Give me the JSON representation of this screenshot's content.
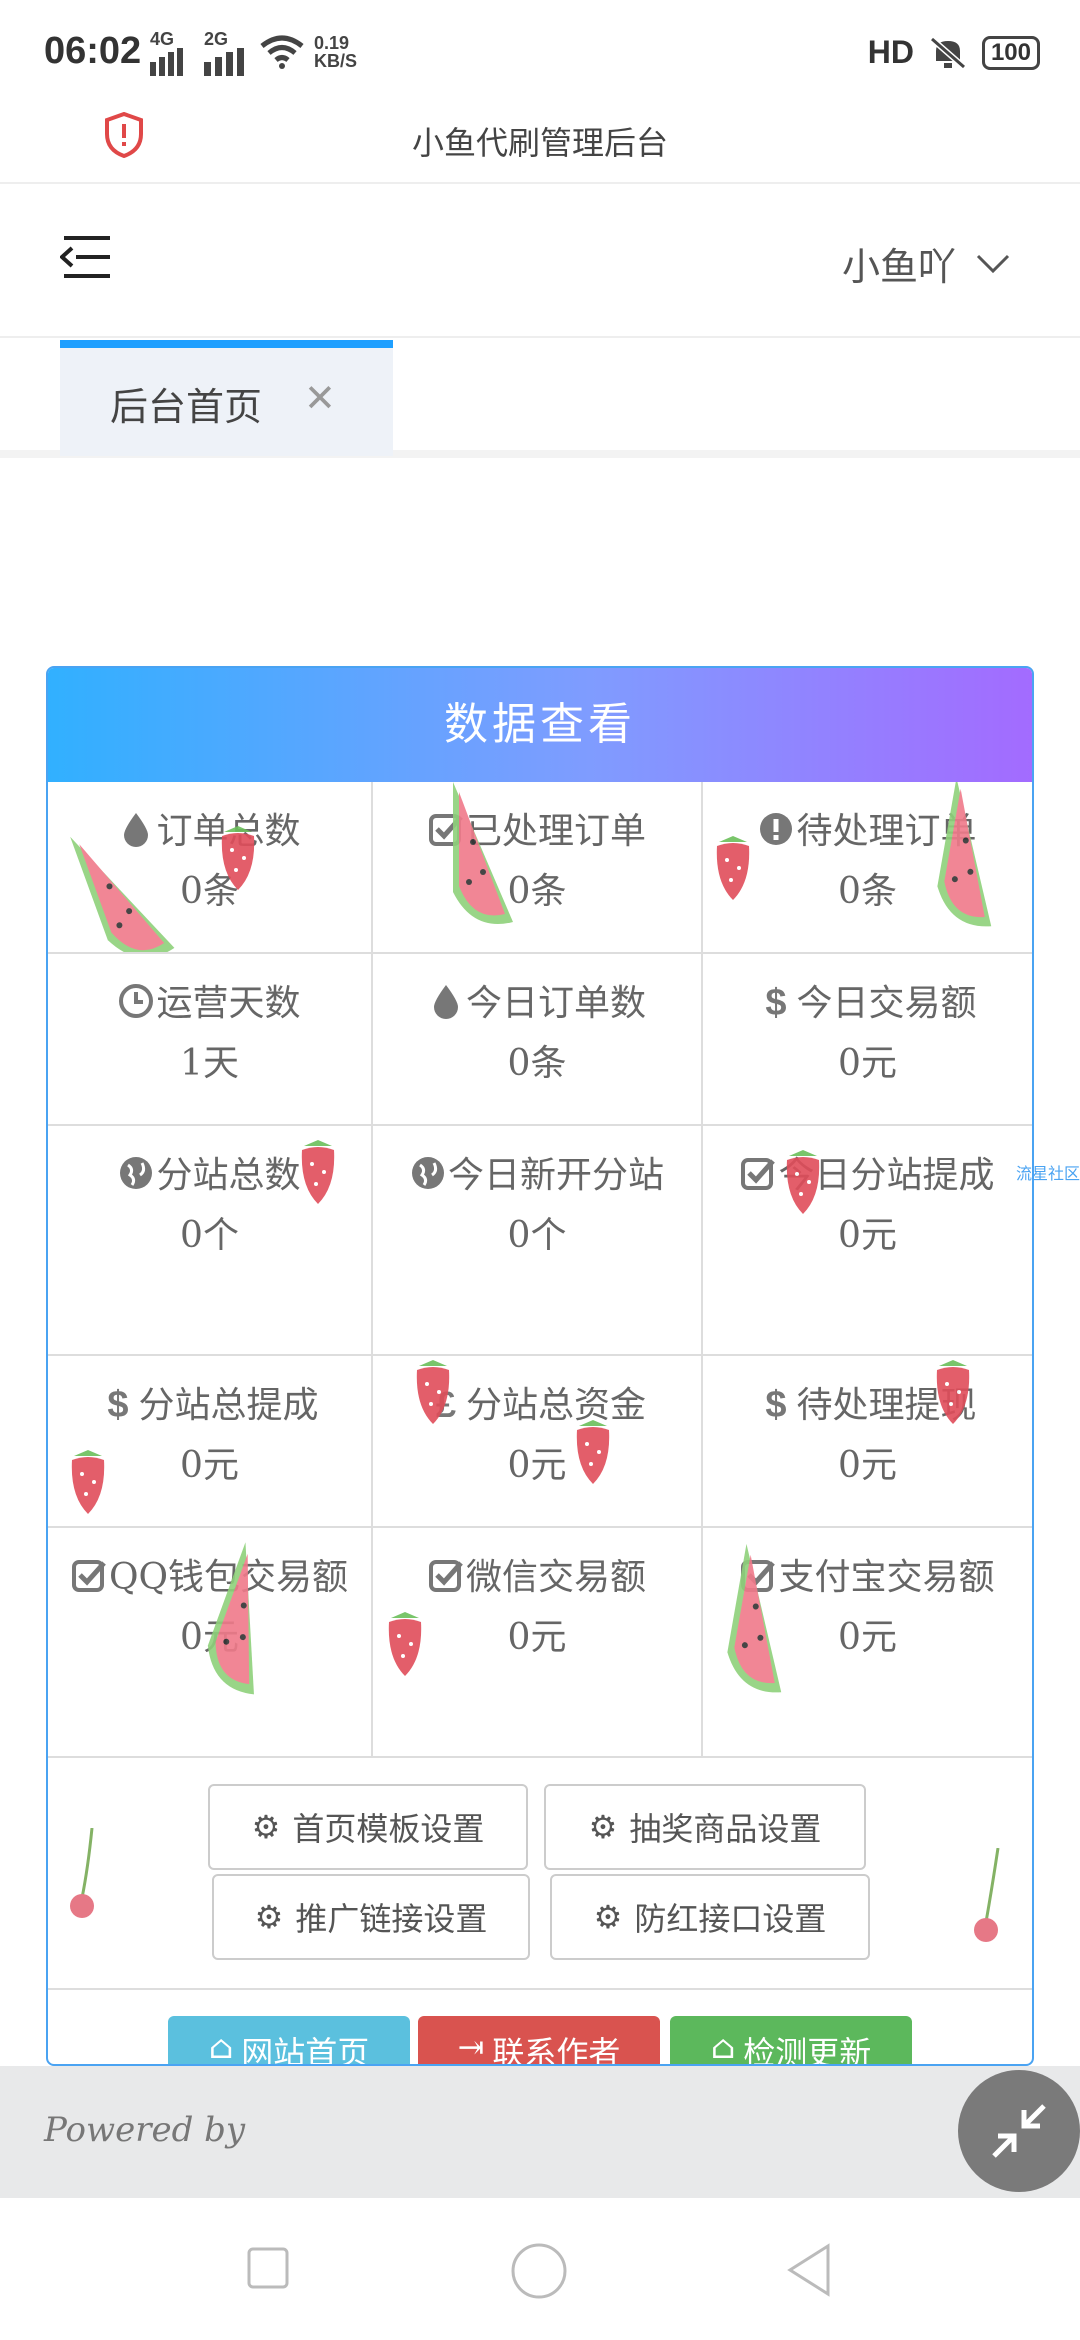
{
  "status_bar": {
    "time": "06:02",
    "net1": "4G",
    "net2": "2G",
    "speed_value": "0.19",
    "speed_unit": "KB/S",
    "hd": "HD",
    "battery": "100"
  },
  "browser": {
    "title": "小鱼代刷管理后台"
  },
  "header": {
    "username": "小鱼吖"
  },
  "tabs": [
    {
      "label": "后台首页"
    }
  ],
  "panel": {
    "title": "数据查看",
    "stats": [
      {
        "label": "订单总数",
        "value": "0条",
        "icon": "drop-icon"
      },
      {
        "label": "已处理订单",
        "value": "0条",
        "icon": "check-square-icon"
      },
      {
        "label": "待处理订单",
        "value": "0条",
        "icon": "exclamation-circle-icon"
      },
      {
        "label": "运营天数",
        "value": "1天",
        "icon": "clock-icon"
      },
      {
        "label": "今日订单数",
        "value": "0条",
        "icon": "drop-icon"
      },
      {
        "label": "今日交易额",
        "value": "0元",
        "icon": "dollar-icon"
      },
      {
        "label": "分站总数",
        "value": "0个",
        "icon": "globe-icon"
      },
      {
        "label": "今日新开分站",
        "value": "0个",
        "icon": "globe-icon"
      },
      {
        "label": "今日分站提成",
        "value": "0元",
        "icon": "check-square-icon"
      },
      {
        "label": "分站总提成",
        "value": "0元",
        "icon": "dollar-icon"
      },
      {
        "label": "分站总资金",
        "value": "0元",
        "icon": "pound-icon"
      },
      {
        "label": "待处理提现",
        "value": "0元",
        "icon": "dollar-icon"
      },
      {
        "label": "QQ钱包交易额",
        "value": "0元",
        "icon": "check-square-icon"
      },
      {
        "label": "微信交易额",
        "value": "0元",
        "icon": "check-square-icon"
      },
      {
        "label": "支付宝交易额",
        "value": "0元",
        "icon": "check-square-icon"
      }
    ],
    "settings_buttons": [
      {
        "label": "首页模板设置"
      },
      {
        "label": "抽奖商品设置"
      },
      {
        "label": "推广链接设置"
      },
      {
        "label": "防红接口设置"
      }
    ],
    "action_buttons": [
      {
        "label": "网站首页",
        "color": "#5bc0de"
      },
      {
        "label": "联系作者",
        "color": "#d9534f"
      },
      {
        "label": "检测更新",
        "color": "#5cb85c"
      }
    ]
  },
  "footer": {
    "powered_by": "Powered by"
  },
  "watermark": "流星社区"
}
